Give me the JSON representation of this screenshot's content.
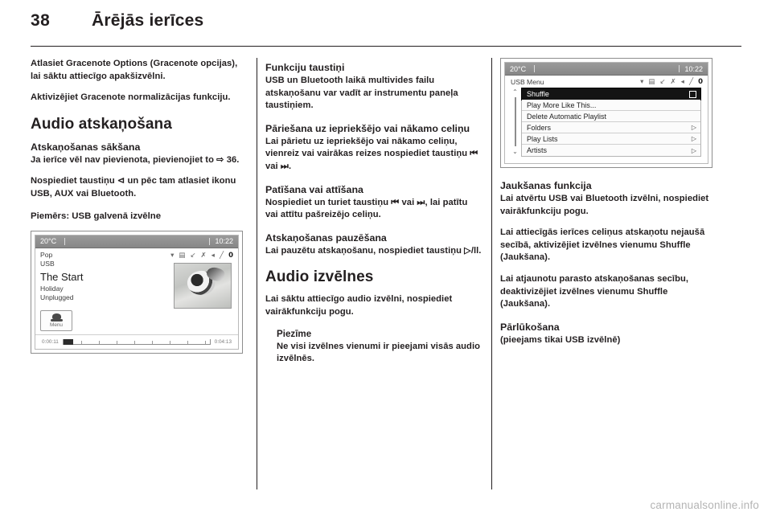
{
  "header": {
    "page_number": "38",
    "chapter_title": "Ārējās ierīces"
  },
  "columns": {
    "left": {
      "intro_paragraph_1": "Atlasiet Gracenote Options (Gracenote opcijas), lai sāktu attiecīgo apakšizvēlni.",
      "intro_paragraph_2": "Aktivizējiet Gracenote normalizācijas funkciju.",
      "section_title": "Audio atskaņošana",
      "sub_title": "Atskaņošanas sākšana",
      "paragraph_1": "Ja ierīce vēl nav pievienota, pievienojiet to ⇨ 36.",
      "paragraph_2": "Nospiediet taustiņu ⊲ un pēc tam atlasiet ikonu USB, AUX vai Bluetooth.",
      "figure_caption": "Piemērs: USB galvenā izvēlne"
    },
    "middle": {
      "sub_title_1": "Funkciju taustiņi",
      "paragraph_1": "USB un Bluetooth laikā multivides failu atskaņošanu var vadīt ar instrumentu paneļa taustiņiem.",
      "sub_title_2": "Pāriešana uz iepriekšējo vai nākamo celiņu",
      "paragraph_2": "Lai pārietu uz iepriekšējo vai nākamo celiņu, vienreiz vai vairākas reizes nospiediet taustiņu ⏮ vai ⏭.",
      "sub_title_3": "Patīšana vai attīšana",
      "paragraph_3": "Nospiediet un turiet taustiņu ⏮ vai ⏭, lai patītu vai attītu pašreizējo celiņu.",
      "sub_title_4": "Atskaņošanas pauzēšana",
      "paragraph_4": "Lai pauzētu atskaņošanu, nospiediet taustiņu ▷/ll.",
      "section_title": "Audio izvēlnes",
      "paragraph_5": "Lai sāktu attiecīgo audio izvēlni, nospiediet vairākfunkciju pogu.",
      "note_title": "Piezīme",
      "note_text": "Ne visi izvēlnes vienumi ir pieejami visās audio izvēlnēs."
    },
    "right": {
      "sub_title_1": "Jaukšanas funkcija",
      "paragraph_1": "Lai atvērtu USB vai Bluetooth izvēlni, nospiediet vairākfunkciju pogu.",
      "paragraph_2": "Lai attiecīgās ierīces celiņus atskaņotu nejaušā secībā, aktivizējiet izvēlnes vienumu Shuffle (Jaukšana).",
      "paragraph_3": "Lai atjaunotu parasto atskaņošanas secību, deaktivizējiet izvēlnes vienumu Shuffle (Jaukšana).",
      "sub_title_2": "Pārlūkošana",
      "paragraph_4": "(pieejams tikai USB izvēlnē)"
    }
  },
  "figures": {
    "now_playing": {
      "status": {
        "temperature": "20°C",
        "clock": "10:22"
      },
      "icons": [
        "wifi-icon",
        "phone-icon",
        "shuffle-repeat-icon",
        "shuffle-icon",
        "mute-icon",
        "call-icon",
        "battery-icon"
      ],
      "genre": "Pop",
      "source": "USB",
      "track_title": "The Start",
      "album": "Holiday",
      "artist": "Unplugged",
      "menu_button_label": "Menu",
      "elapsed_time": "0:00:11",
      "total_time": "0:04:13"
    },
    "usb_menu": {
      "status": {
        "temperature": "20°C",
        "clock": "10:22"
      },
      "menu_title": "USB Menu",
      "items": [
        {
          "label": "Shuffle",
          "type": "checkbox",
          "selected": true
        },
        {
          "label": "Play More Like This...",
          "type": "plain",
          "selected": false
        },
        {
          "label": "Delete Automatic Playlist",
          "type": "plain",
          "selected": false
        },
        {
          "label": "Folders",
          "type": "submenu",
          "selected": false
        },
        {
          "label": "Play Lists",
          "type": "submenu",
          "selected": false
        },
        {
          "label": "Artists",
          "type": "submenu",
          "selected": false
        }
      ],
      "scroll_up": "⌃",
      "scroll_down": "⌄",
      "submenu_arrow": "▷"
    }
  },
  "watermark": "carmanualsonline.info",
  "colors": {
    "text": "#231f20",
    "rule": "#231f20",
    "screen_border": "#8d8d8d",
    "status_bar": "#8f8f8f",
    "selected_row": "#141414",
    "watermark": "#b4b4b4"
  }
}
